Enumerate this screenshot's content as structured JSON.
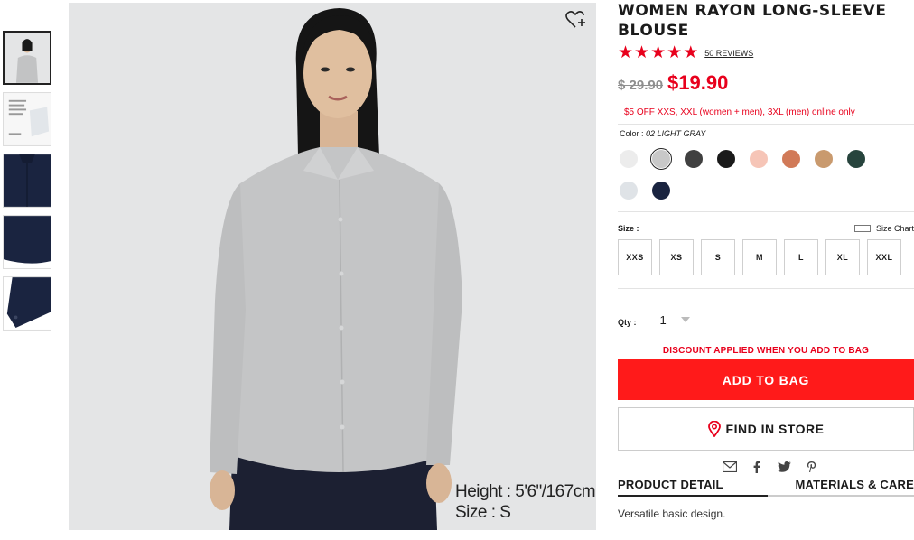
{
  "product": {
    "title_line1": "WOMEN RAYON LONG-SLEEVE",
    "title_line2": "BLOUSE",
    "stars": [
      "★",
      "★",
      "★",
      "★",
      "★"
    ],
    "reviews_label": "50 REVIEWS",
    "old_price": "$ 29.90",
    "new_price": "$19.90",
    "promo": "$5 OFF XXS, XXL (women + men), 3XL (men) online only"
  },
  "color": {
    "label": "Color :",
    "selected": "02 LIGHT GRAY",
    "swatches": [
      {
        "name": "off-white",
        "hex": "#ececec"
      },
      {
        "name": "light-gray",
        "hex": "#c8c8c8",
        "selected": true
      },
      {
        "name": "dark-gray",
        "hex": "#404040"
      },
      {
        "name": "black",
        "hex": "#1a1a1a"
      },
      {
        "name": "pink",
        "hex": "#f6c5b7"
      },
      {
        "name": "orange",
        "hex": "#d17a58"
      },
      {
        "name": "beige",
        "hex": "#c99a6e"
      },
      {
        "name": "dark-green",
        "hex": "#27443d"
      },
      {
        "name": "light-blue",
        "hex": "#dfe3e7"
      },
      {
        "name": "navy",
        "hex": "#1a2440"
      }
    ]
  },
  "size": {
    "label": "Size :",
    "chart_label": "Size Chart",
    "options": [
      "XXS",
      "XS",
      "S",
      "M",
      "L",
      "XL",
      "XXL"
    ]
  },
  "qty": {
    "label": "Qty :",
    "value": "1"
  },
  "discount_note": "DISCOUNT APPLIED WHEN YOU ADD TO BAG",
  "add_to_bag": "ADD TO BAG",
  "find_in_store": "FIND IN STORE",
  "share": {
    "icons": [
      "email-icon",
      "facebook-icon",
      "twitter-icon",
      "pinterest-icon"
    ]
  },
  "tabs": {
    "product_detail": "PRODUCT DETAIL",
    "materials_care": "MATERIALS & CARE"
  },
  "description": "Versatile basic design.",
  "model_info": {
    "height": "Height : 5'6\"/167cm",
    "size": "Size : S"
  },
  "colors": {
    "accent_red": "#e8001c",
    "button_red": "#ff1a1a"
  }
}
